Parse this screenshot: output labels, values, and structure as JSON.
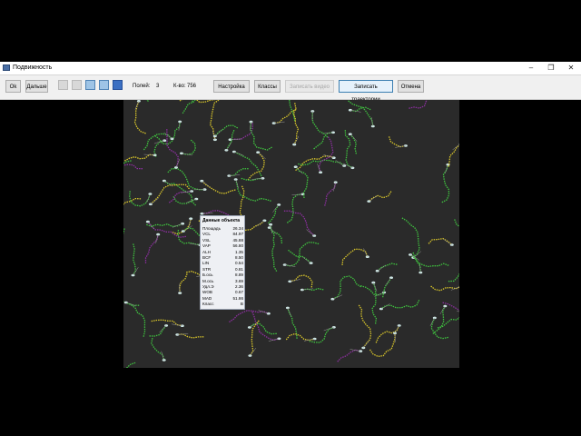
{
  "window": {
    "title": "Подвижность"
  },
  "window_controls": [
    "–",
    "❐",
    "✕"
  ],
  "toolbar": {
    "ok_label": "Ok",
    "next_label": "Дальше",
    "fields_label": "Полей:",
    "fields_value": "3",
    "count_label": "К-во:",
    "count_value": "756",
    "settings_label": "Настройка",
    "classes_label": "Классы",
    "record_video_label": "Записать видео",
    "record_tracks_label": "Записать траектории",
    "cancel_label": "Отмена"
  },
  "object_data": {
    "title": "Данные объекта",
    "rows": [
      {
        "key": "Площадь",
        "value": "26.34"
      },
      {
        "key": "VCL",
        "value": "84.97"
      },
      {
        "key": "VSL",
        "value": "45.88"
      },
      {
        "key": "VAP",
        "value": "56.80"
      },
      {
        "key": "ALH",
        "value": "1.35"
      },
      {
        "key": "BCF",
        "value": "8.50"
      },
      {
        "key": "LIN",
        "value": "0.54"
      },
      {
        "key": "STR",
        "value": "0.81"
      },
      {
        "key": "Б.ось",
        "value": "8.89"
      },
      {
        "key": "М.ось",
        "value": "3.69"
      },
      {
        "key": "Удл.Э",
        "value": "2.36"
      },
      {
        "key": "WOB",
        "value": "0.67"
      },
      {
        "key": "MAD",
        "value": "51.86"
      },
      {
        "key": "Класс",
        "value": "B"
      }
    ]
  },
  "colors": {
    "track_green": "#3fc23f",
    "track_yellow": "#d9c62a",
    "track_purple": "#8b2f9e",
    "sperm_head": "#cfe8e6",
    "viewer_bg": "#2a2a2a"
  }
}
